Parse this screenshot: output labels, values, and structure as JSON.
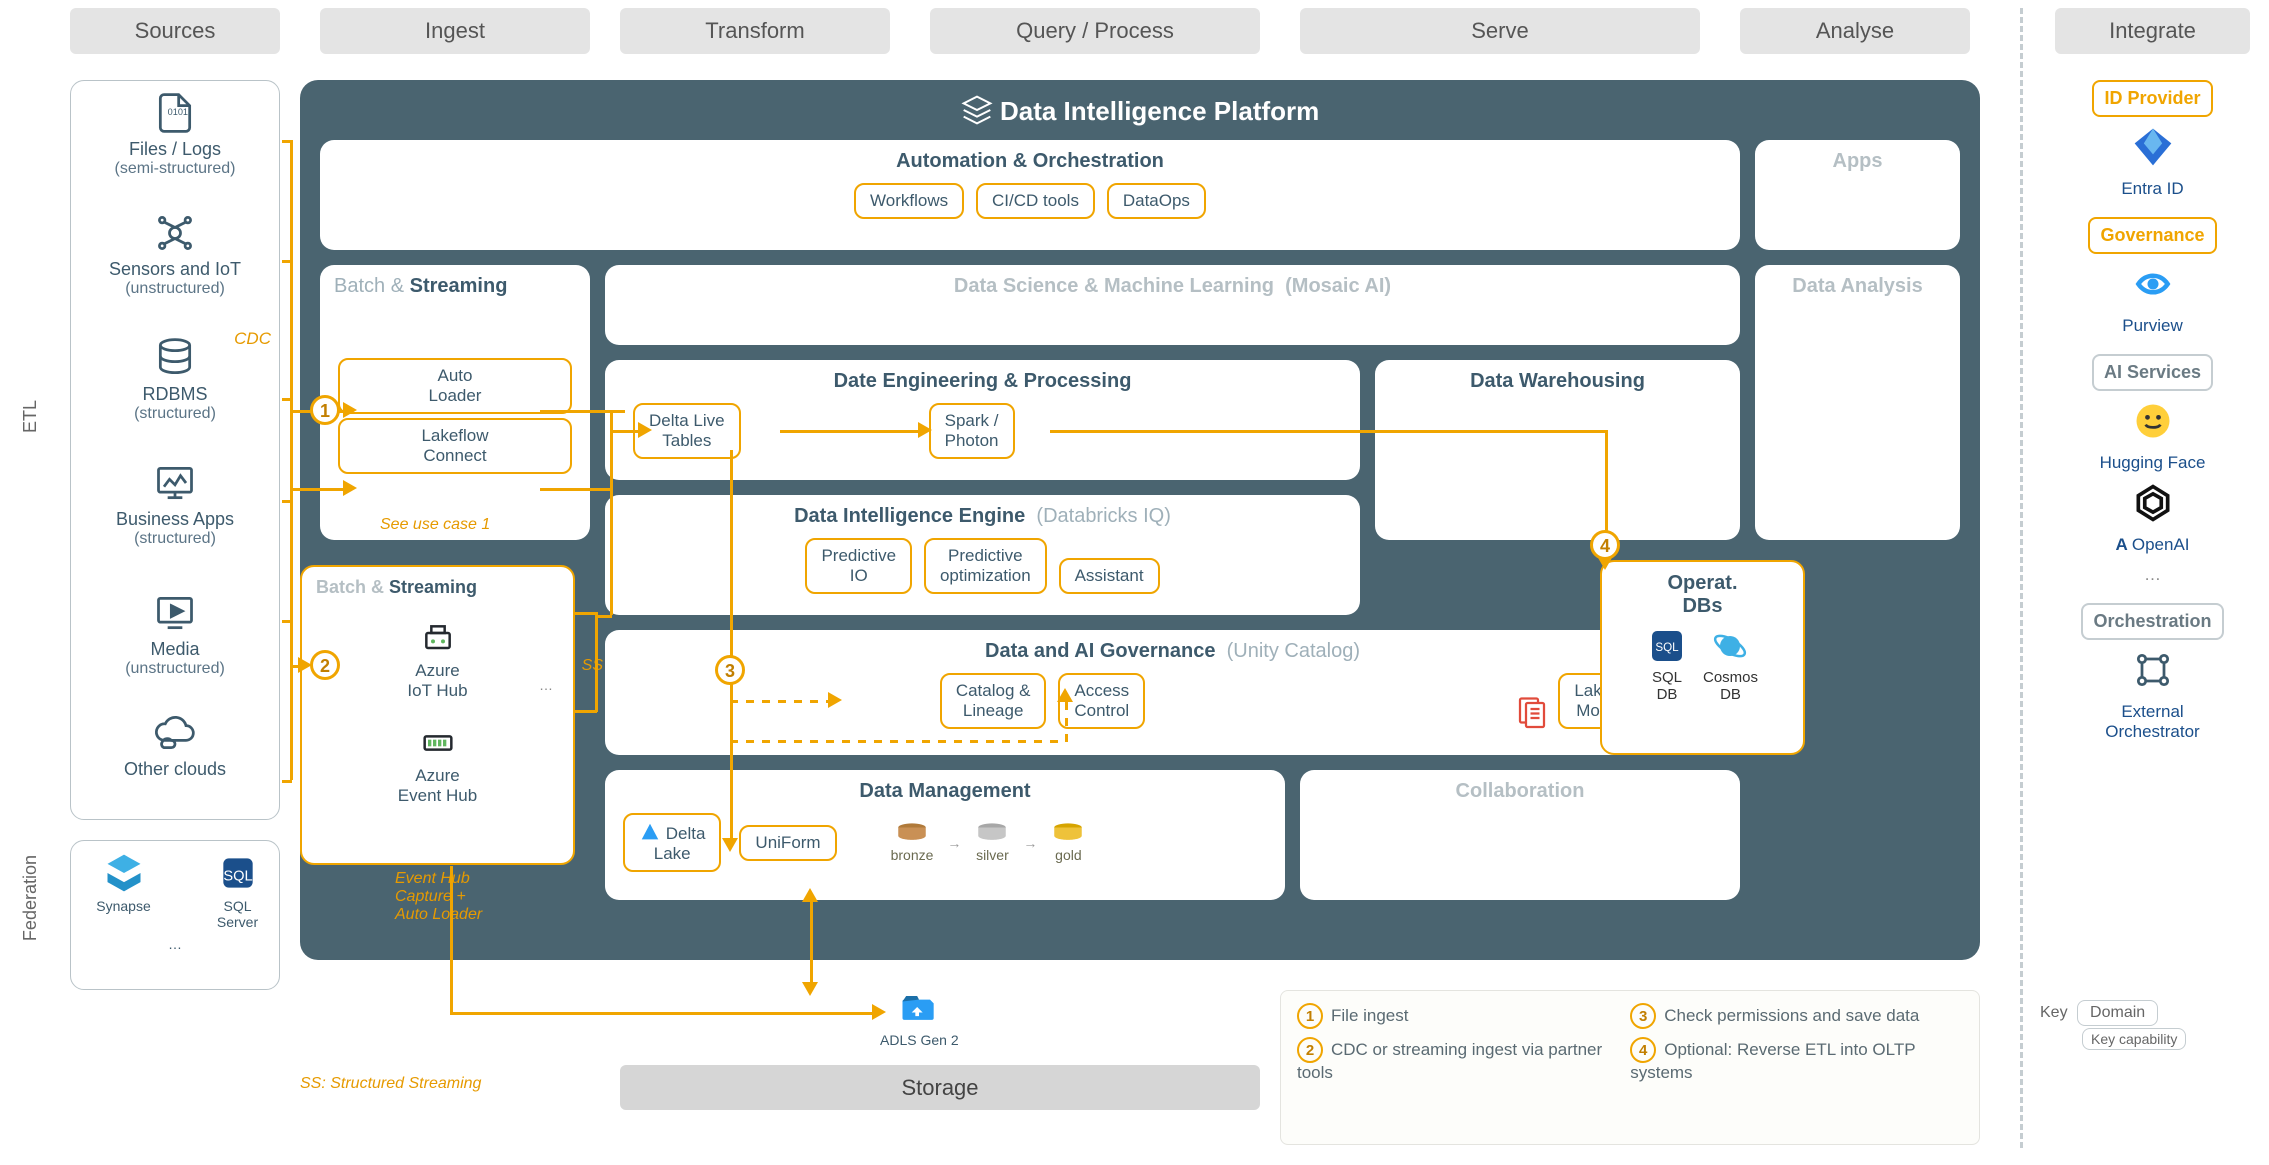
{
  "columns": {
    "sources": "Sources",
    "ingest": "Ingest",
    "transform": "Transform",
    "query": "Query / Process",
    "serve": "Serve",
    "analyse": "Analyse",
    "integrate": "Integrate"
  },
  "side_labels": {
    "etl": "ETL",
    "federation": "Federation"
  },
  "storage": {
    "label": "Storage",
    "adls": "ADLS Gen 2"
  },
  "sources": [
    {
      "icon": "file-icon",
      "primary": "Files / Logs",
      "sub": "(semi-structured)"
    },
    {
      "icon": "sensor-icon",
      "primary": "Sensors and IoT",
      "sub": "(unstructured)"
    },
    {
      "icon": "db-icon",
      "primary": "RDBMS",
      "sub": "(structured)"
    },
    {
      "icon": "app-icon",
      "primary": "Business Apps",
      "sub": "(structured)"
    },
    {
      "icon": "media-icon",
      "primary": "Media",
      "sub": "(unstructured)"
    },
    {
      "icon": "cloud-icon",
      "primary": "Other clouds",
      "sub": ""
    }
  ],
  "cdc_label": "CDC",
  "federation": {
    "synapse": "Synapse",
    "sqlserver": "SQL\nServer",
    "more": "…"
  },
  "dip": {
    "title": "Data Intelligence Platform",
    "automation": {
      "title": "Automation & Orchestration",
      "pills": [
        "Workflows",
        "CI/CD tools",
        "DataOps"
      ]
    },
    "apps": "Apps",
    "batch_inner": {
      "title_prefix": "Batch & ",
      "title_em": "Streaming",
      "auto_loader": "Auto\nLoader",
      "lakeflow": "Lakeflow\nConnect",
      "note": "See use case 1"
    },
    "dsml": {
      "title": "Data Science & Machine Learning",
      "suffix": "(Mosaic AI)"
    },
    "data_analysis": "Data Analysis",
    "de": {
      "title": "Date Engineering & Processing",
      "dlt": "Delta Live\nTables",
      "spark": "Spark /\nPhoton"
    },
    "dw": {
      "title": "Data Warehousing"
    },
    "die": {
      "title": "Data Intelligence Engine",
      "suffix": "(Databricks IQ)",
      "pills": [
        "Predictive\nIO",
        "Predictive\noptimization",
        "Assistant"
      ]
    },
    "gov": {
      "title": "Data and AI Governance",
      "suffix": "(Unity Catalog)",
      "catalog": "Catalog &\nLineage",
      "access": "Access\nControl",
      "monitor": "Lakehouse\nMonitoring"
    },
    "dm": {
      "title": "Data Management",
      "delta": "Delta\nLake",
      "uniform": "UniForm",
      "bronze": "bronze",
      "silver": "silver",
      "gold": "gold"
    },
    "collab": "Collaboration",
    "operat": {
      "title": "Operat.\nDBs",
      "sql": "SQL\nDB",
      "cosmos": "Cosmos\nDB"
    }
  },
  "batch_outer": {
    "title_prefix": "Batch & ",
    "title_em": "Streaming",
    "iot": "Azure\nIoT Hub",
    "event": "Azure\nEvent Hub",
    "more": "…",
    "ss": "SS",
    "note": "Event Hub\nCapture +\nAuto Loader"
  },
  "ss_legend": "SS: Structured Streaming",
  "integrate": {
    "id": {
      "title": "ID Provider",
      "entra": "Entra ID"
    },
    "gov": {
      "title": "Governance",
      "purview": "Purview"
    },
    "ai": {
      "title": "AI Services",
      "hf": "Hugging Face",
      "openai": "OpenAI",
      "more": "…"
    },
    "orch": {
      "title": "Orchestration",
      "ext": "External\nOrchestrator"
    }
  },
  "legend": {
    "1": "File ingest",
    "2": "CDC or streaming ingest via partner tools",
    "3": "Check permissions and save data",
    "4": "Optional: Reverse ETL into OLTP systems"
  },
  "key": {
    "label": "Key",
    "domain": "Domain",
    "cap": "Key capability"
  }
}
